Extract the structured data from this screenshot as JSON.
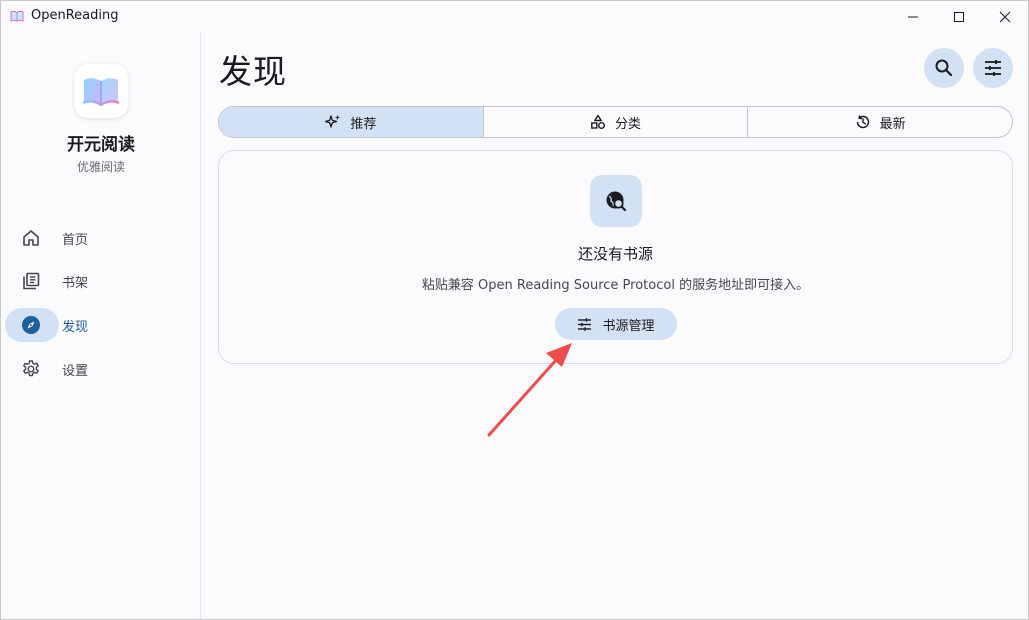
{
  "window": {
    "title": "OpenReading",
    "controls": [
      "minimize",
      "maximize",
      "close"
    ]
  },
  "sidebar": {
    "app_name": "开元阅读",
    "app_subtitle": "优雅阅读",
    "items": [
      {
        "label": "首页",
        "icon": "home-icon",
        "active": false
      },
      {
        "label": "书架",
        "icon": "library-icon",
        "active": false
      },
      {
        "label": "发现",
        "icon": "compass-icon",
        "active": true
      },
      {
        "label": "设置",
        "icon": "gear-icon",
        "active": false
      }
    ]
  },
  "main": {
    "title": "发现",
    "actions": [
      {
        "icon": "search-icon"
      },
      {
        "icon": "tune-icon"
      }
    ],
    "tabs": [
      {
        "label": "推荐",
        "icon": "sparkle-icon",
        "active": true
      },
      {
        "label": "分类",
        "icon": "category-icon",
        "active": false
      },
      {
        "label": "最新",
        "icon": "history-icon",
        "active": false
      }
    ],
    "empty_state": {
      "icon": "travel-explore-icon",
      "title": "还没有书源",
      "description": "粘贴兼容 Open Reading Source Protocol 的服务地址即可接入。",
      "button_label": "书源管理",
      "button_icon": "tune-icon"
    }
  },
  "annotation": {
    "type": "arrow",
    "color": "#ee4d4d",
    "points_to": "source-manage-button"
  },
  "colors": {
    "accent": "#1f5f9c",
    "tonal": "#d3e1f5",
    "background": "#fbfbfe"
  }
}
